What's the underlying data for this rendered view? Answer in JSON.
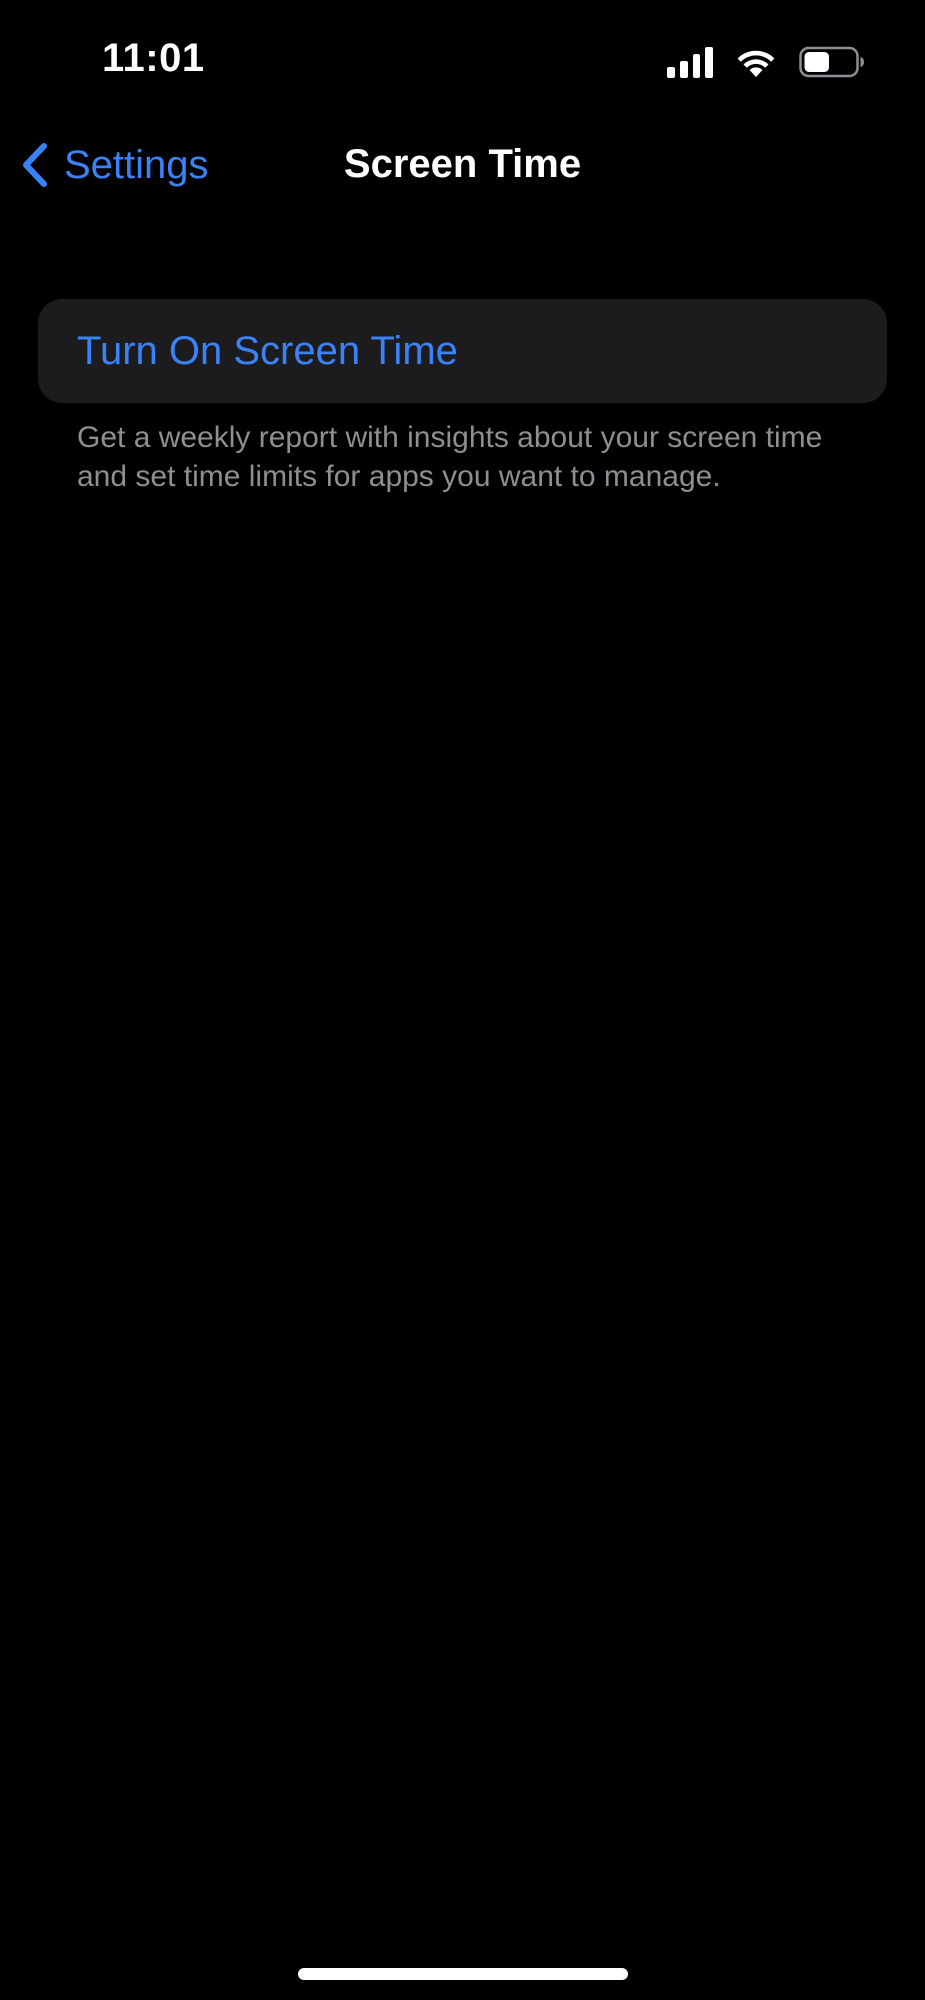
{
  "status_bar": {
    "time": "11:01",
    "icons": [
      "signal-icon",
      "wifi-icon",
      "battery-icon"
    ],
    "battery_level": 0.5
  },
  "nav": {
    "back_label": "Settings",
    "title": "Screen Time"
  },
  "main": {
    "turn_on_label": "Turn On Screen Time",
    "footer": "Get a weekly report with insights about your screen time and set time limits for apps you want to manage."
  },
  "colors": {
    "background": "#000000",
    "accent": "#3a82f7",
    "card": "#1c1c1e",
    "secondary_text": "#8e8e93"
  }
}
